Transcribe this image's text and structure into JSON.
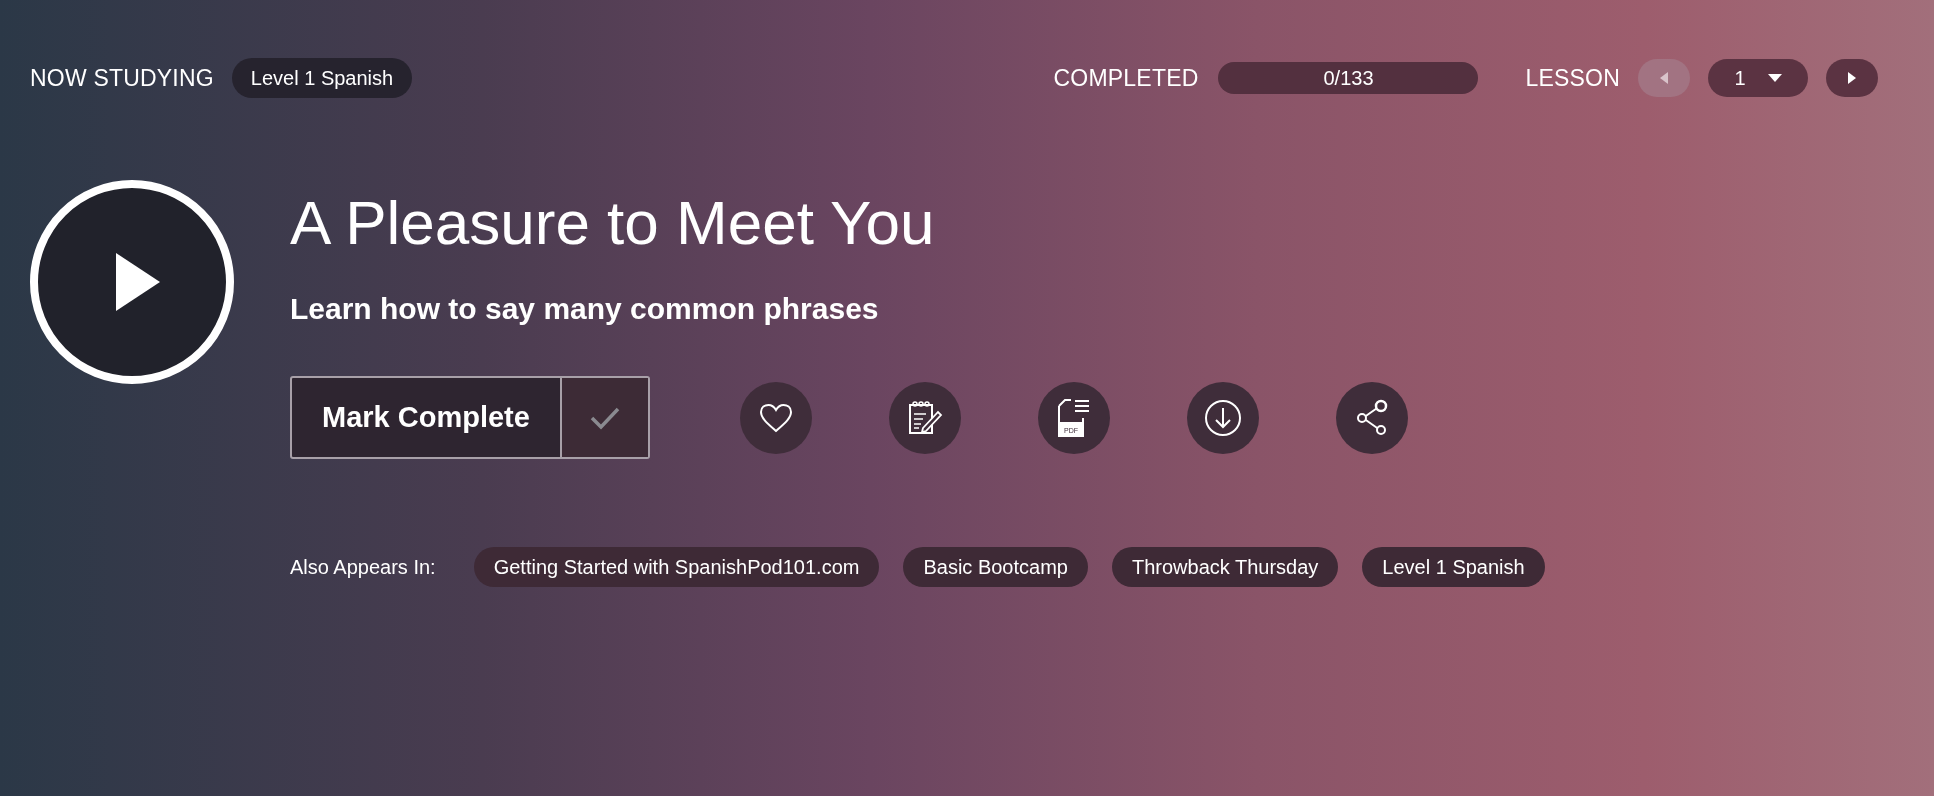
{
  "header": {
    "now_studying_label": "NOW STUDYING",
    "course": "Level 1 Spanish",
    "completed_label": "COMPLETED",
    "progress": {
      "text": "0/133",
      "level": 0
    },
    "lesson_label": "LESSON",
    "lesson_nav": [
      {
        "kind": "prev",
        "disabled": true
      },
      {
        "kind": "select",
        "value": "1"
      },
      {
        "kind": "next",
        "disabled": false
      }
    ]
  },
  "lesson": {
    "title": "A Pleasure to Meet You",
    "subtitle": "Learn how to say many common phrases",
    "mark_complete": {
      "label": "Mark Complete",
      "checked": false
    },
    "actions": [
      {
        "kind": "favorite"
      },
      {
        "kind": "notes"
      },
      {
        "kind": "pdf",
        "label": "PDF"
      },
      {
        "kind": "download"
      },
      {
        "kind": "share"
      }
    ],
    "also_appears_label": "Also Appears In:",
    "also_appears": [
      "Getting Started with SpanishPod101.com",
      "Basic Bootcamp",
      "Throwback Thursday",
      "Level 1 Spanish"
    ]
  }
}
